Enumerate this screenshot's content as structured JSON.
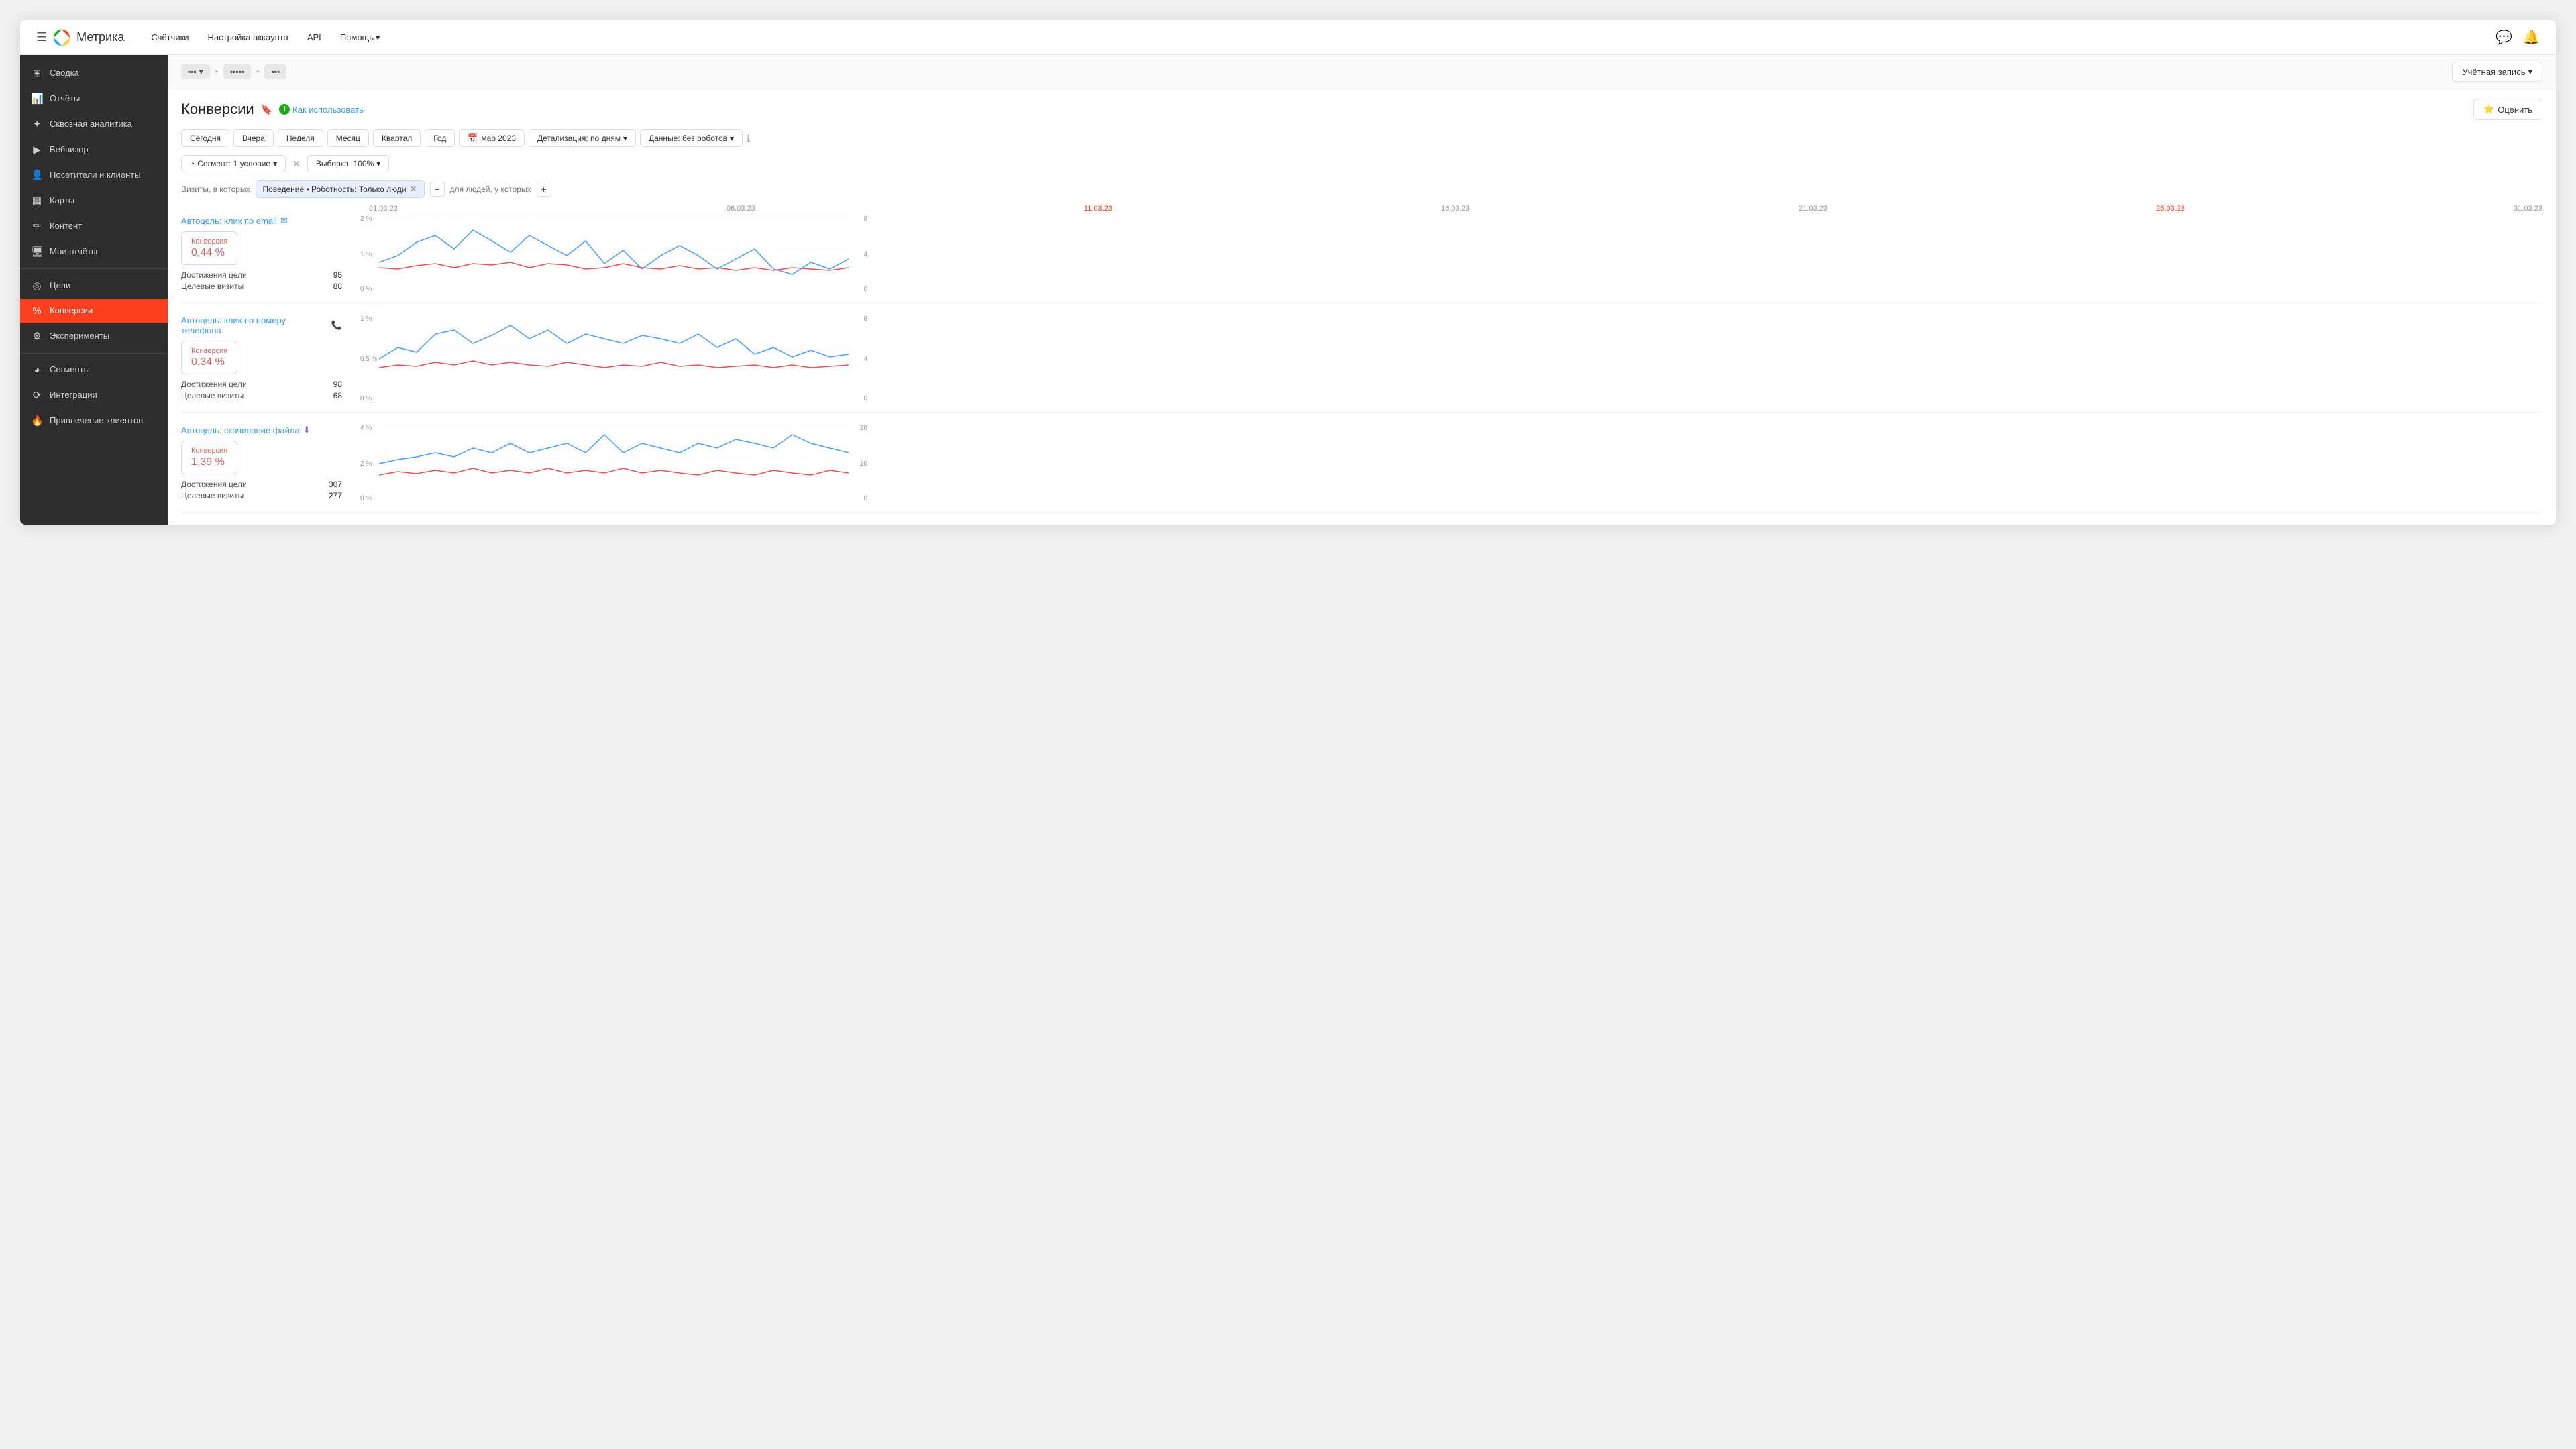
{
  "app": {
    "logo_text": "Метрика",
    "hamburger": "☰"
  },
  "top_nav": {
    "links": [
      "Счётчики",
      "Настройка аккаунта",
      "API",
      "Помощь"
    ],
    "help_has_arrow": true,
    "account_label": "Учётная запись"
  },
  "sidebar": {
    "items": [
      {
        "id": "svod",
        "icon": "⊞",
        "label": "Сводка"
      },
      {
        "id": "otchety",
        "icon": "📊",
        "label": "Отчёты"
      },
      {
        "id": "skvoznaya",
        "icon": "✦",
        "label": "Сквозная аналитика"
      },
      {
        "id": "vebvizor",
        "icon": "▶",
        "label": "Вебвизор"
      },
      {
        "id": "posetiteli",
        "icon": "👤",
        "label": "Посетители и клиенты"
      },
      {
        "id": "karty",
        "icon": "▦",
        "label": "Карты"
      },
      {
        "id": "kontent",
        "icon": "✏",
        "label": "Контент"
      },
      {
        "id": "moi-otchety",
        "icon": "🖥",
        "label": "Мои отчёты"
      },
      {
        "id": "tseli",
        "icon": "◎",
        "label": "Цели"
      },
      {
        "id": "konversii",
        "icon": "%",
        "label": "Конверсии",
        "active": true
      },
      {
        "id": "eksperimenty",
        "icon": "⚙",
        "label": "Эксперименты"
      },
      {
        "id": "segmenty",
        "icon": "◕",
        "label": "Сегменты"
      },
      {
        "id": "integratsii",
        "icon": "⟳",
        "label": "Интеграции"
      },
      {
        "id": "privlechenie",
        "icon": "🔥",
        "label": "Привлечение клиентов"
      }
    ]
  },
  "breadcrumb": {
    "items": [
      "...",
      "...",
      "..."
    ],
    "account_btn": "Учётная запись"
  },
  "page": {
    "title": "Конверсии",
    "how_to_use": "Как использовать",
    "rate_btn": "Оценить"
  },
  "date_filters": {
    "buttons": [
      "Сегодня",
      "Вчера",
      "Неделя",
      "Месяц",
      "Квартал",
      "Год"
    ],
    "date_range": "мар 2023",
    "detail": "Детализация: по дням",
    "data": "Данные: без роботов"
  },
  "segment": {
    "label": "Сегмент: 1 условие",
    "sample_label": "Выборка: 100%"
  },
  "filter": {
    "visits_label": "Визиты, в которых",
    "tag": "Поведение • Роботность: Только люди",
    "people_label": "для людей, у которых"
  },
  "date_axis": {
    "labels": [
      "01.03.23",
      "06.03.23",
      "11.03.23",
      "16.03.23",
      "21.03.23",
      "26.03.23",
      "31.03.23"
    ],
    "highlight_index": 2
  },
  "charts": [
    {
      "id": "email",
      "title": "Автоцель: клик по email",
      "title_icon": "✉",
      "conversion_label": "Конверсия",
      "conversion_value": "0,44 %",
      "stats": [
        {
          "label": "Достижения цели",
          "value": "95"
        },
        {
          "label": "Целевые визиты",
          "value": "88"
        }
      ],
      "y_left": [
        "2 %",
        "1 %",
        "0 %"
      ],
      "y_right": [
        "8",
        "4",
        "0"
      ],
      "blue_points": [
        [
          0,
          30
        ],
        [
          4,
          25
        ],
        [
          8,
          15
        ],
        [
          12,
          10
        ],
        [
          16,
          20
        ],
        [
          20,
          8
        ],
        [
          24,
          15
        ],
        [
          28,
          22
        ],
        [
          32,
          12
        ],
        [
          36,
          18
        ],
        [
          40,
          25
        ],
        [
          44,
          15
        ],
        [
          48,
          30
        ],
        [
          52,
          20
        ],
        [
          56,
          35
        ],
        [
          60,
          25
        ],
        [
          64,
          18
        ],
        [
          68,
          25
        ],
        [
          72,
          35
        ],
        [
          76,
          28
        ],
        [
          80,
          20
        ],
        [
          84,
          35
        ],
        [
          88,
          40
        ],
        [
          92,
          30
        ],
        [
          96,
          35
        ],
        [
          100,
          28
        ]
      ],
      "red_points": [
        [
          0,
          55
        ],
        [
          4,
          58
        ],
        [
          8,
          52
        ],
        [
          12,
          50
        ],
        [
          16,
          55
        ],
        [
          20,
          50
        ],
        [
          24,
          52
        ],
        [
          28,
          48
        ],
        [
          32,
          55
        ],
        [
          36,
          50
        ],
        [
          40,
          52
        ],
        [
          44,
          58
        ],
        [
          48,
          55
        ],
        [
          52,
          50
        ],
        [
          56,
          55
        ],
        [
          60,
          58
        ],
        [
          64,
          52
        ],
        [
          68,
          58
        ],
        [
          72,
          55
        ],
        [
          76,
          60
        ],
        [
          80,
          55
        ],
        [
          84,
          60
        ],
        [
          88,
          55
        ],
        [
          92,
          58
        ],
        [
          96,
          60
        ],
        [
          100,
          55
        ]
      ]
    },
    {
      "id": "phone",
      "title": "Автоцель: клик по номеру телефона",
      "title_icon": "📞",
      "conversion_label": "Конверсия",
      "conversion_value": "0,34 %",
      "stats": [
        {
          "label": "Достижения цели",
          "value": "98"
        },
        {
          "label": "Целевые визиты",
          "value": "68"
        }
      ],
      "y_left": [
        "1 %",
        "0.5 %",
        "0 %"
      ],
      "y_right": [
        "8",
        "4",
        "0"
      ],
      "blue_points": [
        [
          0,
          50
        ],
        [
          4,
          35
        ],
        [
          8,
          40
        ],
        [
          12,
          20
        ],
        [
          16,
          15
        ],
        [
          20,
          30
        ],
        [
          24,
          20
        ],
        [
          28,
          10
        ],
        [
          32,
          25
        ],
        [
          36,
          15
        ],
        [
          40,
          30
        ],
        [
          44,
          20
        ],
        [
          48,
          25
        ],
        [
          52,
          30
        ],
        [
          56,
          20
        ],
        [
          60,
          25
        ],
        [
          64,
          30
        ],
        [
          68,
          20
        ],
        [
          72,
          35
        ],
        [
          76,
          25
        ],
        [
          80,
          45
        ],
        [
          84,
          35
        ],
        [
          88,
          50
        ],
        [
          92,
          40
        ],
        [
          96,
          50
        ],
        [
          100,
          45
        ]
      ],
      "red_points": [
        [
          0,
          60
        ],
        [
          4,
          55
        ],
        [
          8,
          58
        ],
        [
          12,
          52
        ],
        [
          16,
          55
        ],
        [
          20,
          50
        ],
        [
          24,
          55
        ],
        [
          28,
          52
        ],
        [
          32,
          55
        ],
        [
          36,
          58
        ],
        [
          40,
          52
        ],
        [
          44,
          55
        ],
        [
          48,
          60
        ],
        [
          52,
          55
        ],
        [
          56,
          58
        ],
        [
          60,
          52
        ],
        [
          64,
          58
        ],
        [
          68,
          55
        ],
        [
          72,
          60
        ],
        [
          76,
          58
        ],
        [
          80,
          55
        ],
        [
          84,
          60
        ],
        [
          88,
          55
        ],
        [
          92,
          60
        ],
        [
          96,
          58
        ],
        [
          100,
          55
        ]
      ]
    },
    {
      "id": "file",
      "title": "Автоцель: скачивание файла",
      "title_icon": "⬇",
      "conversion_label": "Конверсия",
      "conversion_value": "1,39 %",
      "stats": [
        {
          "label": "Достижения цели",
          "value": "307"
        },
        {
          "label": "Целевые визиты",
          "value": "277"
        }
      ],
      "y_left": [
        "4 %",
        "2 %",
        "0 %"
      ],
      "y_right": [
        "20",
        "10",
        "0"
      ],
      "blue_points": [
        [
          0,
          45
        ],
        [
          4,
          40
        ],
        [
          8,
          35
        ],
        [
          12,
          30
        ],
        [
          16,
          35
        ],
        [
          20,
          25
        ],
        [
          24,
          30
        ],
        [
          28,
          20
        ],
        [
          32,
          30
        ],
        [
          36,
          25
        ],
        [
          40,
          20
        ],
        [
          44,
          30
        ],
        [
          48,
          10
        ],
        [
          52,
          30
        ],
        [
          56,
          20
        ],
        [
          60,
          25
        ],
        [
          64,
          30
        ],
        [
          68,
          20
        ],
        [
          72,
          25
        ],
        [
          76,
          15
        ],
        [
          80,
          20
        ],
        [
          84,
          25
        ],
        [
          88,
          10
        ],
        [
          92,
          20
        ],
        [
          96,
          25
        ],
        [
          100,
          30
        ]
      ],
      "red_points": [
        [
          0,
          60
        ],
        [
          4,
          55
        ],
        [
          8,
          58
        ],
        [
          12,
          52
        ],
        [
          16,
          55
        ],
        [
          20,
          50
        ],
        [
          24,
          55
        ],
        [
          28,
          52
        ],
        [
          32,
          55
        ],
        [
          36,
          50
        ],
        [
          40,
          55
        ],
        [
          44,
          52
        ],
        [
          48,
          55
        ],
        [
          52,
          50
        ],
        [
          56,
          55
        ],
        [
          60,
          52
        ],
        [
          64,
          55
        ],
        [
          68,
          58
        ],
        [
          72,
          52
        ],
        [
          76,
          55
        ],
        [
          80,
          58
        ],
        [
          84,
          52
        ],
        [
          88,
          55
        ],
        [
          92,
          58
        ],
        [
          96,
          52
        ],
        [
          100,
          55
        ]
      ]
    }
  ]
}
